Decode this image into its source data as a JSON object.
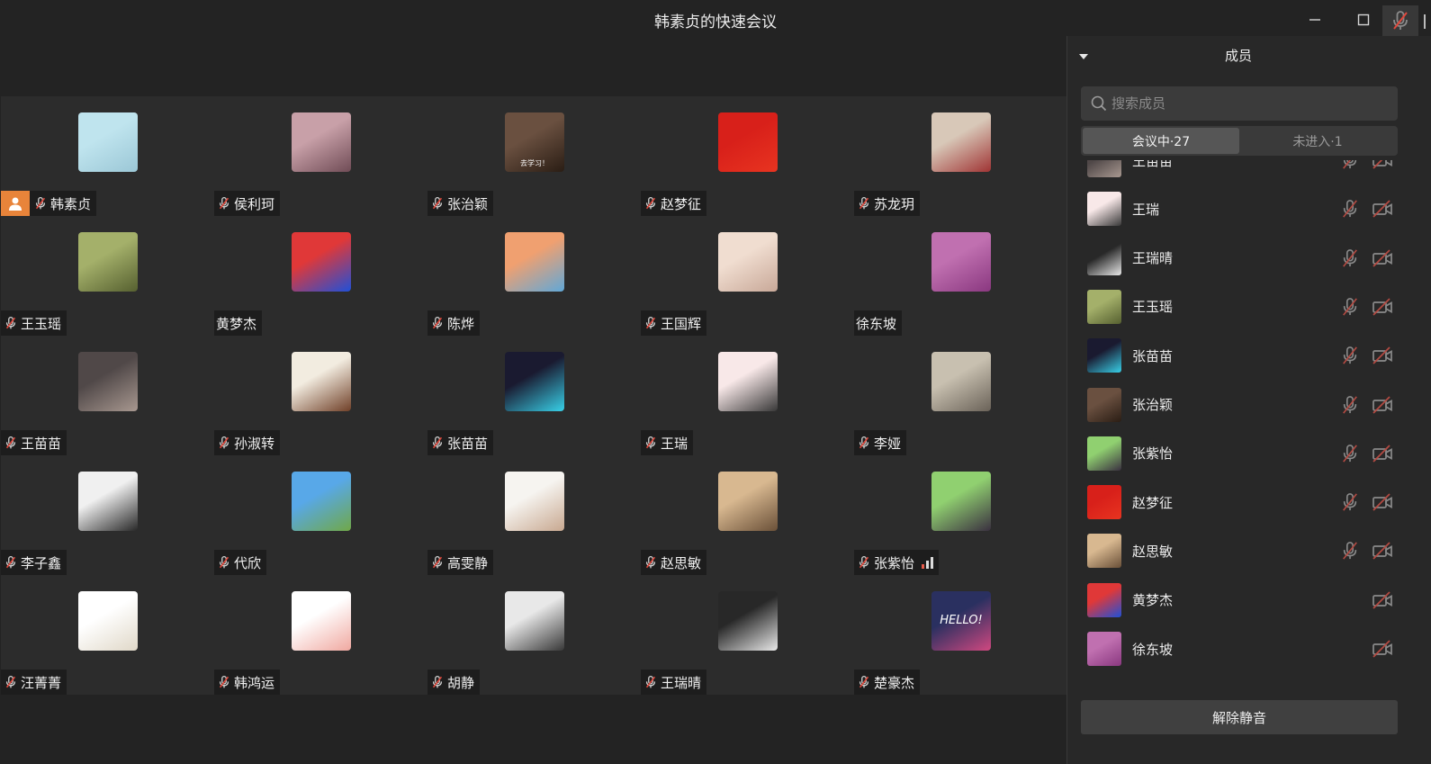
{
  "window": {
    "title": "韩素贞的快速会议"
  },
  "participants": [
    {
      "name": "韩素贞",
      "muted": true,
      "host": true,
      "colors": [
        "#bfe4ee",
        "#9bc7d6"
      ]
    },
    {
      "name": "侯利珂",
      "muted": true,
      "colors": [
        "#c8a0a8",
        "#704c56"
      ]
    },
    {
      "name": "张治颖",
      "muted": true,
      "colors": [
        "#6a5040",
        "#2a1d14"
      ],
      "avatar_text": "去学习！"
    },
    {
      "name": "赵梦征",
      "muted": true,
      "colors": [
        "#d8201a",
        "#e83420"
      ]
    },
    {
      "name": "苏龙玥",
      "muted": true,
      "colors": [
        "#d8c8b8",
        "#a03434"
      ]
    },
    {
      "name": "王玉瑶",
      "muted": true,
      "colors": [
        "#a4b06a",
        "#566030"
      ]
    },
    {
      "name": "黄梦杰",
      "muted": false,
      "colors": [
        "#e03838",
        "#2050d8"
      ]
    },
    {
      "name": "陈烨",
      "muted": true,
      "colors": [
        "#f0a070",
        "#60a8d8"
      ]
    },
    {
      "name": "王国辉",
      "muted": true,
      "colors": [
        "#f0ddd0",
        "#c8a898"
      ]
    },
    {
      "name": "徐东坡",
      "muted": false,
      "colors": [
        "#c070b0",
        "#8a3880"
      ]
    },
    {
      "name": "王苗苗",
      "muted": true,
      "colors": [
        "#504848",
        "#a89890"
      ]
    },
    {
      "name": "孙淑转",
      "muted": true,
      "colors": [
        "#f2ece0",
        "#704028"
      ]
    },
    {
      "name": "张苗苗",
      "muted": true,
      "colors": [
        "#1a1a30",
        "#38d0e8"
      ]
    },
    {
      "name": "王瑞",
      "muted": true,
      "colors": [
        "#f8e8e8",
        "#383838"
      ]
    },
    {
      "name": "李娅",
      "muted": true,
      "colors": [
        "#c8c0b0",
        "#6a6258"
      ]
    },
    {
      "name": "李子鑫",
      "muted": true,
      "colors": [
        "#f0f0f0",
        "#282828"
      ]
    },
    {
      "name": "代欣",
      "muted": true,
      "colors": [
        "#58a8e8",
        "#70a848"
      ]
    },
    {
      "name": "高雯静",
      "muted": true,
      "colors": [
        "#f6f4f0",
        "#c8a890"
      ]
    },
    {
      "name": "赵思敏",
      "muted": true,
      "colors": [
        "#d8b890",
        "#6a5038"
      ]
    },
    {
      "name": "张紫怡",
      "muted": true,
      "signal": true,
      "colors": [
        "#90d070",
        "#3a3040"
      ]
    },
    {
      "name": "汪菁菁",
      "muted": true,
      "colors": [
        "#ffffff",
        "#e0d8c8"
      ]
    },
    {
      "name": "韩鸿运",
      "muted": true,
      "colors": [
        "#ffffff",
        "#f0a8a0"
      ]
    },
    {
      "name": "胡静",
      "muted": true,
      "colors": [
        "#e8e8e8",
        "#383838"
      ]
    },
    {
      "name": "王瑞晴",
      "muted": true,
      "colors": [
        "#282828",
        "#e8e8e8"
      ]
    },
    {
      "name": "楚豪杰",
      "muted": true,
      "colors": [
        "#2a3060",
        "#d04880"
      ],
      "avatar_text": "HELLO!"
    }
  ],
  "panel": {
    "title": "成员",
    "search_placeholder": "搜索成员",
    "tabs": [
      {
        "label": "会议中·27",
        "active": true
      },
      {
        "label": "未进入·1",
        "active": false
      }
    ],
    "members": [
      {
        "name": "王苗苗",
        "mic_muted": true,
        "colors": [
          "#504848",
          "#a89890"
        ]
      },
      {
        "name": "王瑞",
        "mic_muted": true,
        "colors": [
          "#f8e8e8",
          "#383838"
        ]
      },
      {
        "name": "王瑞晴",
        "mic_muted": true,
        "colors": [
          "#282828",
          "#e8e8e8"
        ]
      },
      {
        "name": "王玉瑶",
        "mic_muted": true,
        "colors": [
          "#a4b06a",
          "#566030"
        ]
      },
      {
        "name": "张苗苗",
        "mic_muted": true,
        "colors": [
          "#1a1a30",
          "#38d0e8"
        ]
      },
      {
        "name": "张治颖",
        "mic_muted": true,
        "colors": [
          "#6a5040",
          "#2a1d14"
        ]
      },
      {
        "name": "张紫怡",
        "mic_muted": true,
        "colors": [
          "#90d070",
          "#3a3040"
        ]
      },
      {
        "name": "赵梦征",
        "mic_muted": true,
        "colors": [
          "#d8201a",
          "#e83420"
        ]
      },
      {
        "name": "赵思敏",
        "mic_muted": true,
        "colors": [
          "#d8b890",
          "#6a5038"
        ]
      },
      {
        "name": "黄梦杰",
        "mic_muted": false,
        "colors": [
          "#e03838",
          "#2050d8"
        ]
      },
      {
        "name": "徐东坡",
        "mic_muted": false,
        "colors": [
          "#c070b0",
          "#8a3880"
        ]
      }
    ],
    "unmute_button": "解除静音"
  },
  "icons": {
    "mic_muted": "mic-off-icon",
    "camera_off": "camera-off-icon",
    "host": "host-icon",
    "search": "search-icon",
    "collapse": "caret-down-icon",
    "minimize": "minimize-icon",
    "maximize": "maximize-icon"
  },
  "theme": {
    "mute_red": "#e0483c",
    "host_orange": "#e8843a"
  }
}
